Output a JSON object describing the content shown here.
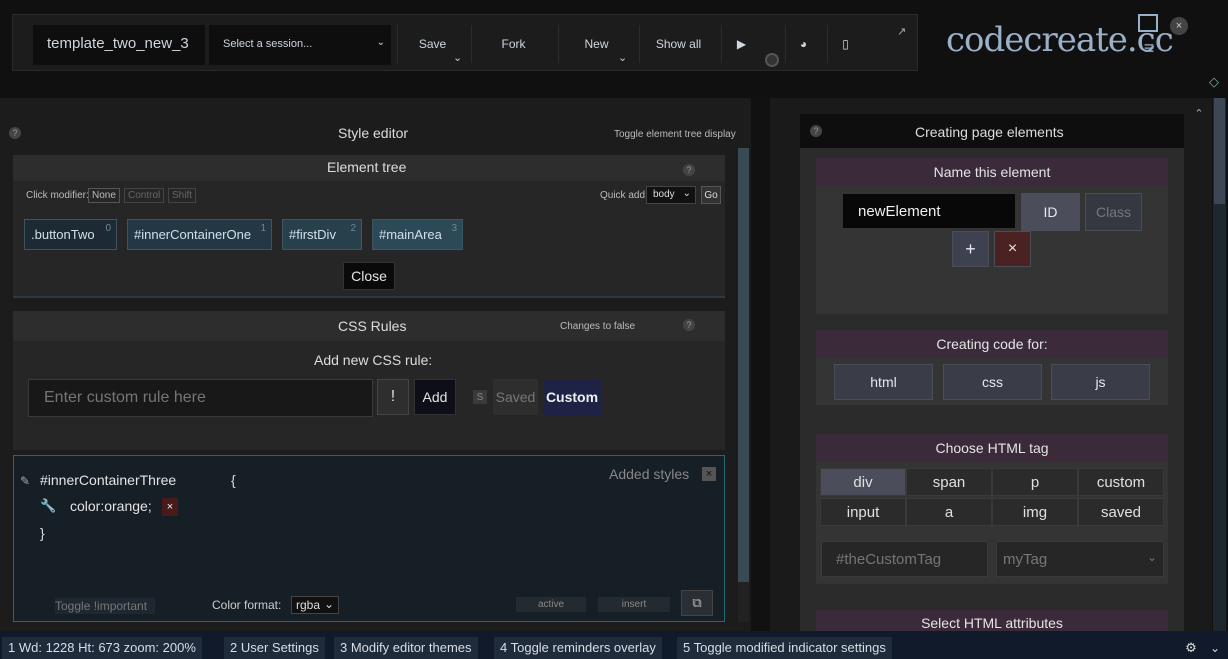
{
  "toolbar": {
    "template_name": "template_two_new_3",
    "session_placeholder": "Select a session...",
    "save": "Save",
    "fork": "Fork",
    "new": "New",
    "show_all": "Show all"
  },
  "brand": {
    "logo": "codecreate.cc"
  },
  "style_editor": {
    "title": "Style editor",
    "toggle_tree": "Toggle element tree display",
    "element_tree": {
      "title": "Element tree",
      "click_modifier": "Click modifier:",
      "modifiers": [
        "None",
        "Control",
        "Shift"
      ],
      "quick_add": "Quick add:",
      "quick_add_value": "body",
      "go": "Go",
      "chips": [
        {
          "label": ".buttonTwo",
          "index": "0"
        },
        {
          "label": "#innerContainerOne",
          "index": "1"
        },
        {
          "label": "#firstDiv",
          "index": "2"
        },
        {
          "label": "#mainArea",
          "index": "3"
        }
      ],
      "close": "Close"
    },
    "css_rules": {
      "title": "CSS Rules",
      "changes": "Changes to false",
      "add_new": "Add new CSS rule:",
      "input_placeholder": "Enter custom rule here",
      "important": "!",
      "add": "Add",
      "s_key": "S",
      "saved": "Saved",
      "custom": "Custom"
    },
    "rule_block": {
      "selector": "#innerContainerThree",
      "open_brace": "{",
      "declaration": "color:orange;",
      "close_brace": "}",
      "added_styles": "Added styles",
      "toggle_important": "Toggle !important",
      "color_format_label": "Color format:",
      "color_format_value": "rgba",
      "active": "active",
      "insert": "insert"
    }
  },
  "creating": {
    "title": "Creating page elements",
    "name_title": "Name this element",
    "name_value": "newElement",
    "id": "ID",
    "class": "Class",
    "plus": "+",
    "times": "×",
    "code_title": "Creating code for:",
    "code_tabs": [
      "html",
      "css",
      "js"
    ],
    "tag_title": "Choose HTML tag",
    "tags": [
      "div",
      "span",
      "p",
      "custom",
      "input",
      "a",
      "img",
      "saved"
    ],
    "custom_tag_placeholder": "#theCustomTag",
    "tag_select": "myTag",
    "attributes_title": "Select HTML attributes"
  },
  "statusbar": {
    "items": [
      "1  Wd: 1228    Ht: 673 zoom: 200%",
      "2  User Settings",
      "3  Modify editor themes",
      "4  Toggle reminders overlay",
      "5  Toggle modified indicator settings"
    ]
  },
  "icons": [
    "layout-icon",
    "close-icon",
    "menu-icon",
    "expand-icon",
    "play-icon",
    "palette-icon",
    "tablet-icon",
    "help-icon",
    "pencil-icon",
    "wrench-icon",
    "copy-icon",
    "gear-icon",
    "chevron-down-icon",
    "chevron-up-icon"
  ]
}
